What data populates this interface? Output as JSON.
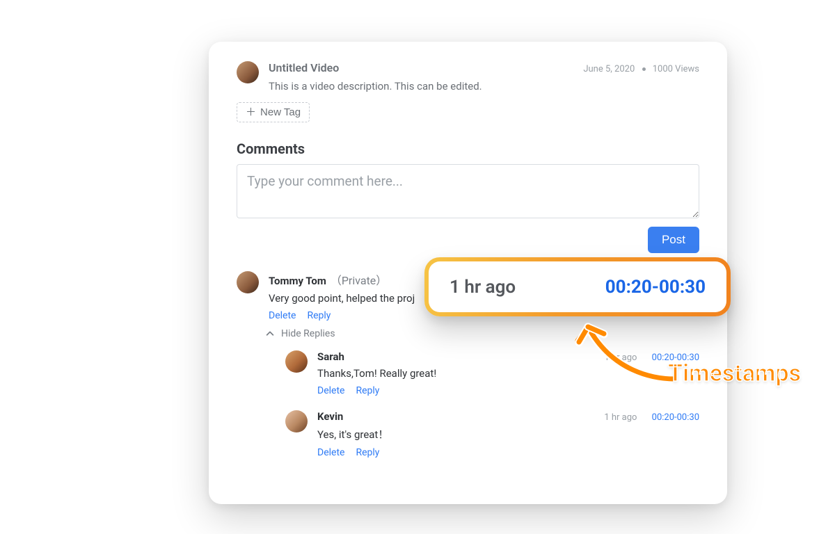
{
  "header": {
    "title": "Untitled Video",
    "date": "June 5, 2020",
    "views": "1000 Views",
    "description": "This is a video description. This can be edited."
  },
  "newTagLabel": "New Tag",
  "sectionTitle": "Comments",
  "commentInput": {
    "placeholder": "Type your comment here..."
  },
  "postLabel": "Post",
  "actions": {
    "delete": "Delete",
    "reply": "Reply"
  },
  "hideRepliesLabel": "Hide Replies",
  "comments": [
    {
      "author": "Tommy Tom",
      "privacy": "（Private）",
      "time": "",
      "timestamp": "",
      "text": "Very good point, helped the proj",
      "replies": [
        {
          "author": "Sarah",
          "time": "1 hr ago",
          "timestamp": "00:20-00:30",
          "text": "Thanks,Tom! Really great!"
        },
        {
          "author": "Kevin",
          "time": "1 hr ago",
          "timestamp": "00:20-00:30",
          "text": "Yes, it's great！"
        }
      ]
    }
  ],
  "callout": {
    "time": "1 hr ago",
    "timestamp": "00:20-00:30"
  },
  "annotationLabel": "Timestamps",
  "colors": {
    "accentBlue": "#2f7bf5",
    "annotationOrange": "#ff8a00"
  }
}
